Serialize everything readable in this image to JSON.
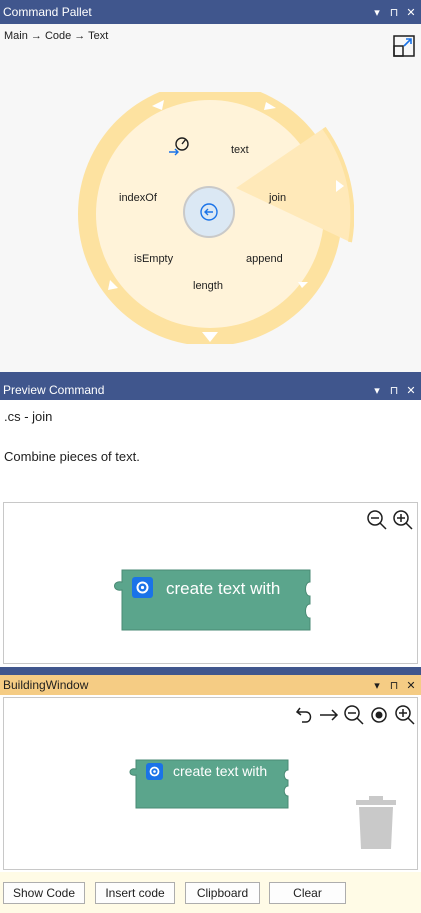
{
  "command_pallet": {
    "title": "Command Pallet",
    "breadcrumb": "Main → Code → Text",
    "wheel_items": [
      "text",
      "join",
      "append",
      "length",
      "isEmpty",
      "indexOf"
    ],
    "selected_item": "join"
  },
  "preview": {
    "title": "Preview Command",
    "file": ".cs - join",
    "description": "Combine pieces of text.",
    "block_label": "create text with"
  },
  "building": {
    "title": "BuildingWindow",
    "block_label": "create text with",
    "buttons": [
      "Show Code",
      "Insert code",
      "Clipboard",
      "Clear"
    ]
  },
  "title_controls": [
    "▾",
    "⊓",
    "✕"
  ],
  "colors": {
    "title_bar": "#40568d",
    "title_bar_active": "#f5cc84",
    "wheel_ring": "#fde2a0",
    "wheel_fill": "#fff3d9",
    "wheel_selected": "#ffe9b9",
    "block": "#5ba58c",
    "icon_blue": "#1a73e8"
  }
}
